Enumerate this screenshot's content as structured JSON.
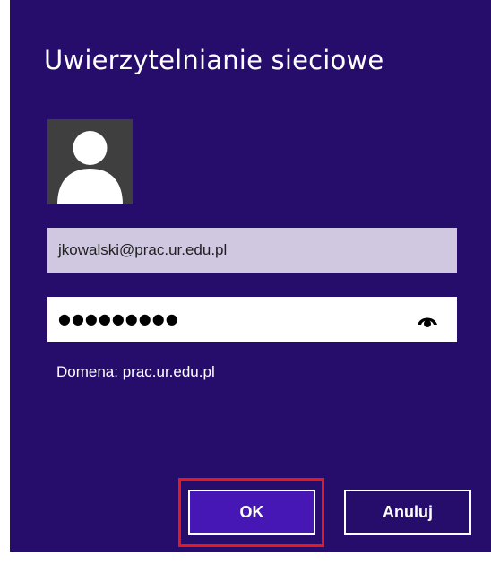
{
  "dialog": {
    "title": "Uwierzytelnianie sieciowe",
    "background_color": "#260d6b"
  },
  "account": {
    "avatar_icon": "user-silhouette-icon",
    "username": "jkowalski@prac.ur.edu.pl",
    "password_masked": "●●●●●●●●●",
    "reveal_icon": "eye-reveal-icon",
    "domain": "Domena: prac.ur.edu.pl"
  },
  "buttons": {
    "ok_label": "OK",
    "ok_color": "#4617b4",
    "cancel_label": "Anuluj",
    "highlight_color": "#e41a1a"
  }
}
